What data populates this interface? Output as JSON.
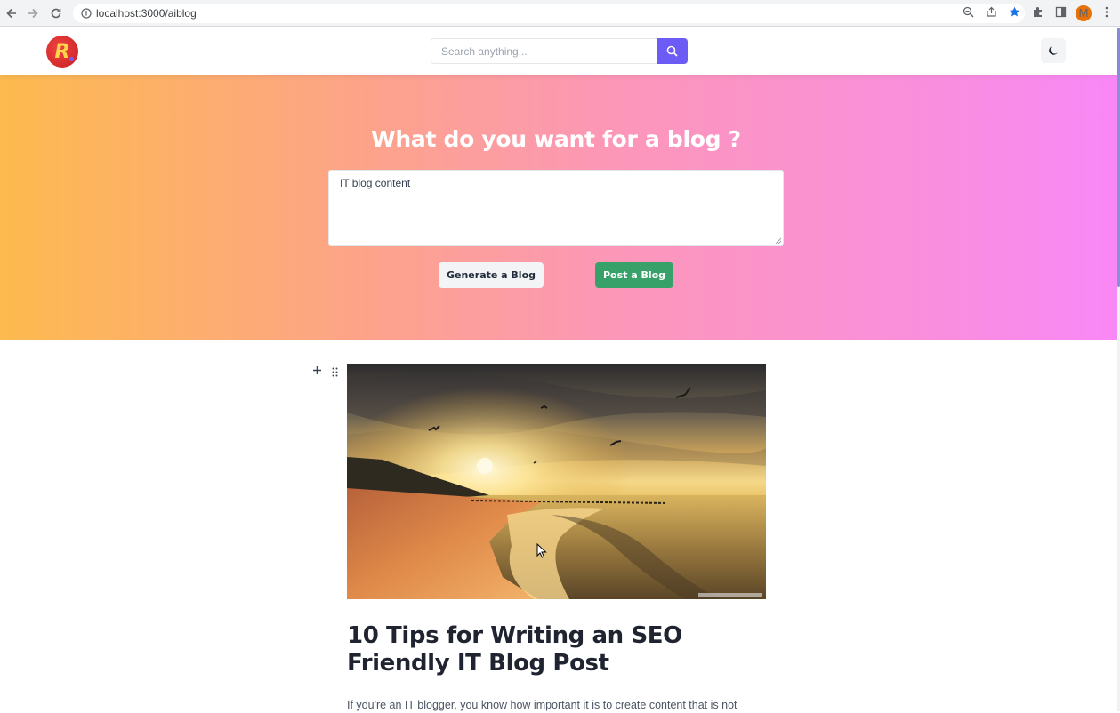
{
  "browser": {
    "url": "localhost:3000/aiblog",
    "profile_initial": "M"
  },
  "header": {
    "search": {
      "placeholder": "Search anything..."
    }
  },
  "hero": {
    "title": "What do you want for a blog ?",
    "prompt_value": "IT blog content",
    "generate_label": "Generate a Blog",
    "post_label": "Post a Blog"
  },
  "post": {
    "title": "10 Tips for Writing an SEO Friendly IT Blog Post",
    "body": "If you're an IT blogger, you know how important it is to create content that is not"
  },
  "colors": {
    "accent": "#6d5bf5",
    "post_button": "#38a169",
    "hero_gradient_start": "#fdba4e",
    "hero_gradient_end": "#f988f7"
  },
  "icons": {
    "search_button": "search-icon",
    "theme_toggle": "moon-icon",
    "block_add": "plus-icon",
    "block_drag": "drag-handle-icon"
  }
}
